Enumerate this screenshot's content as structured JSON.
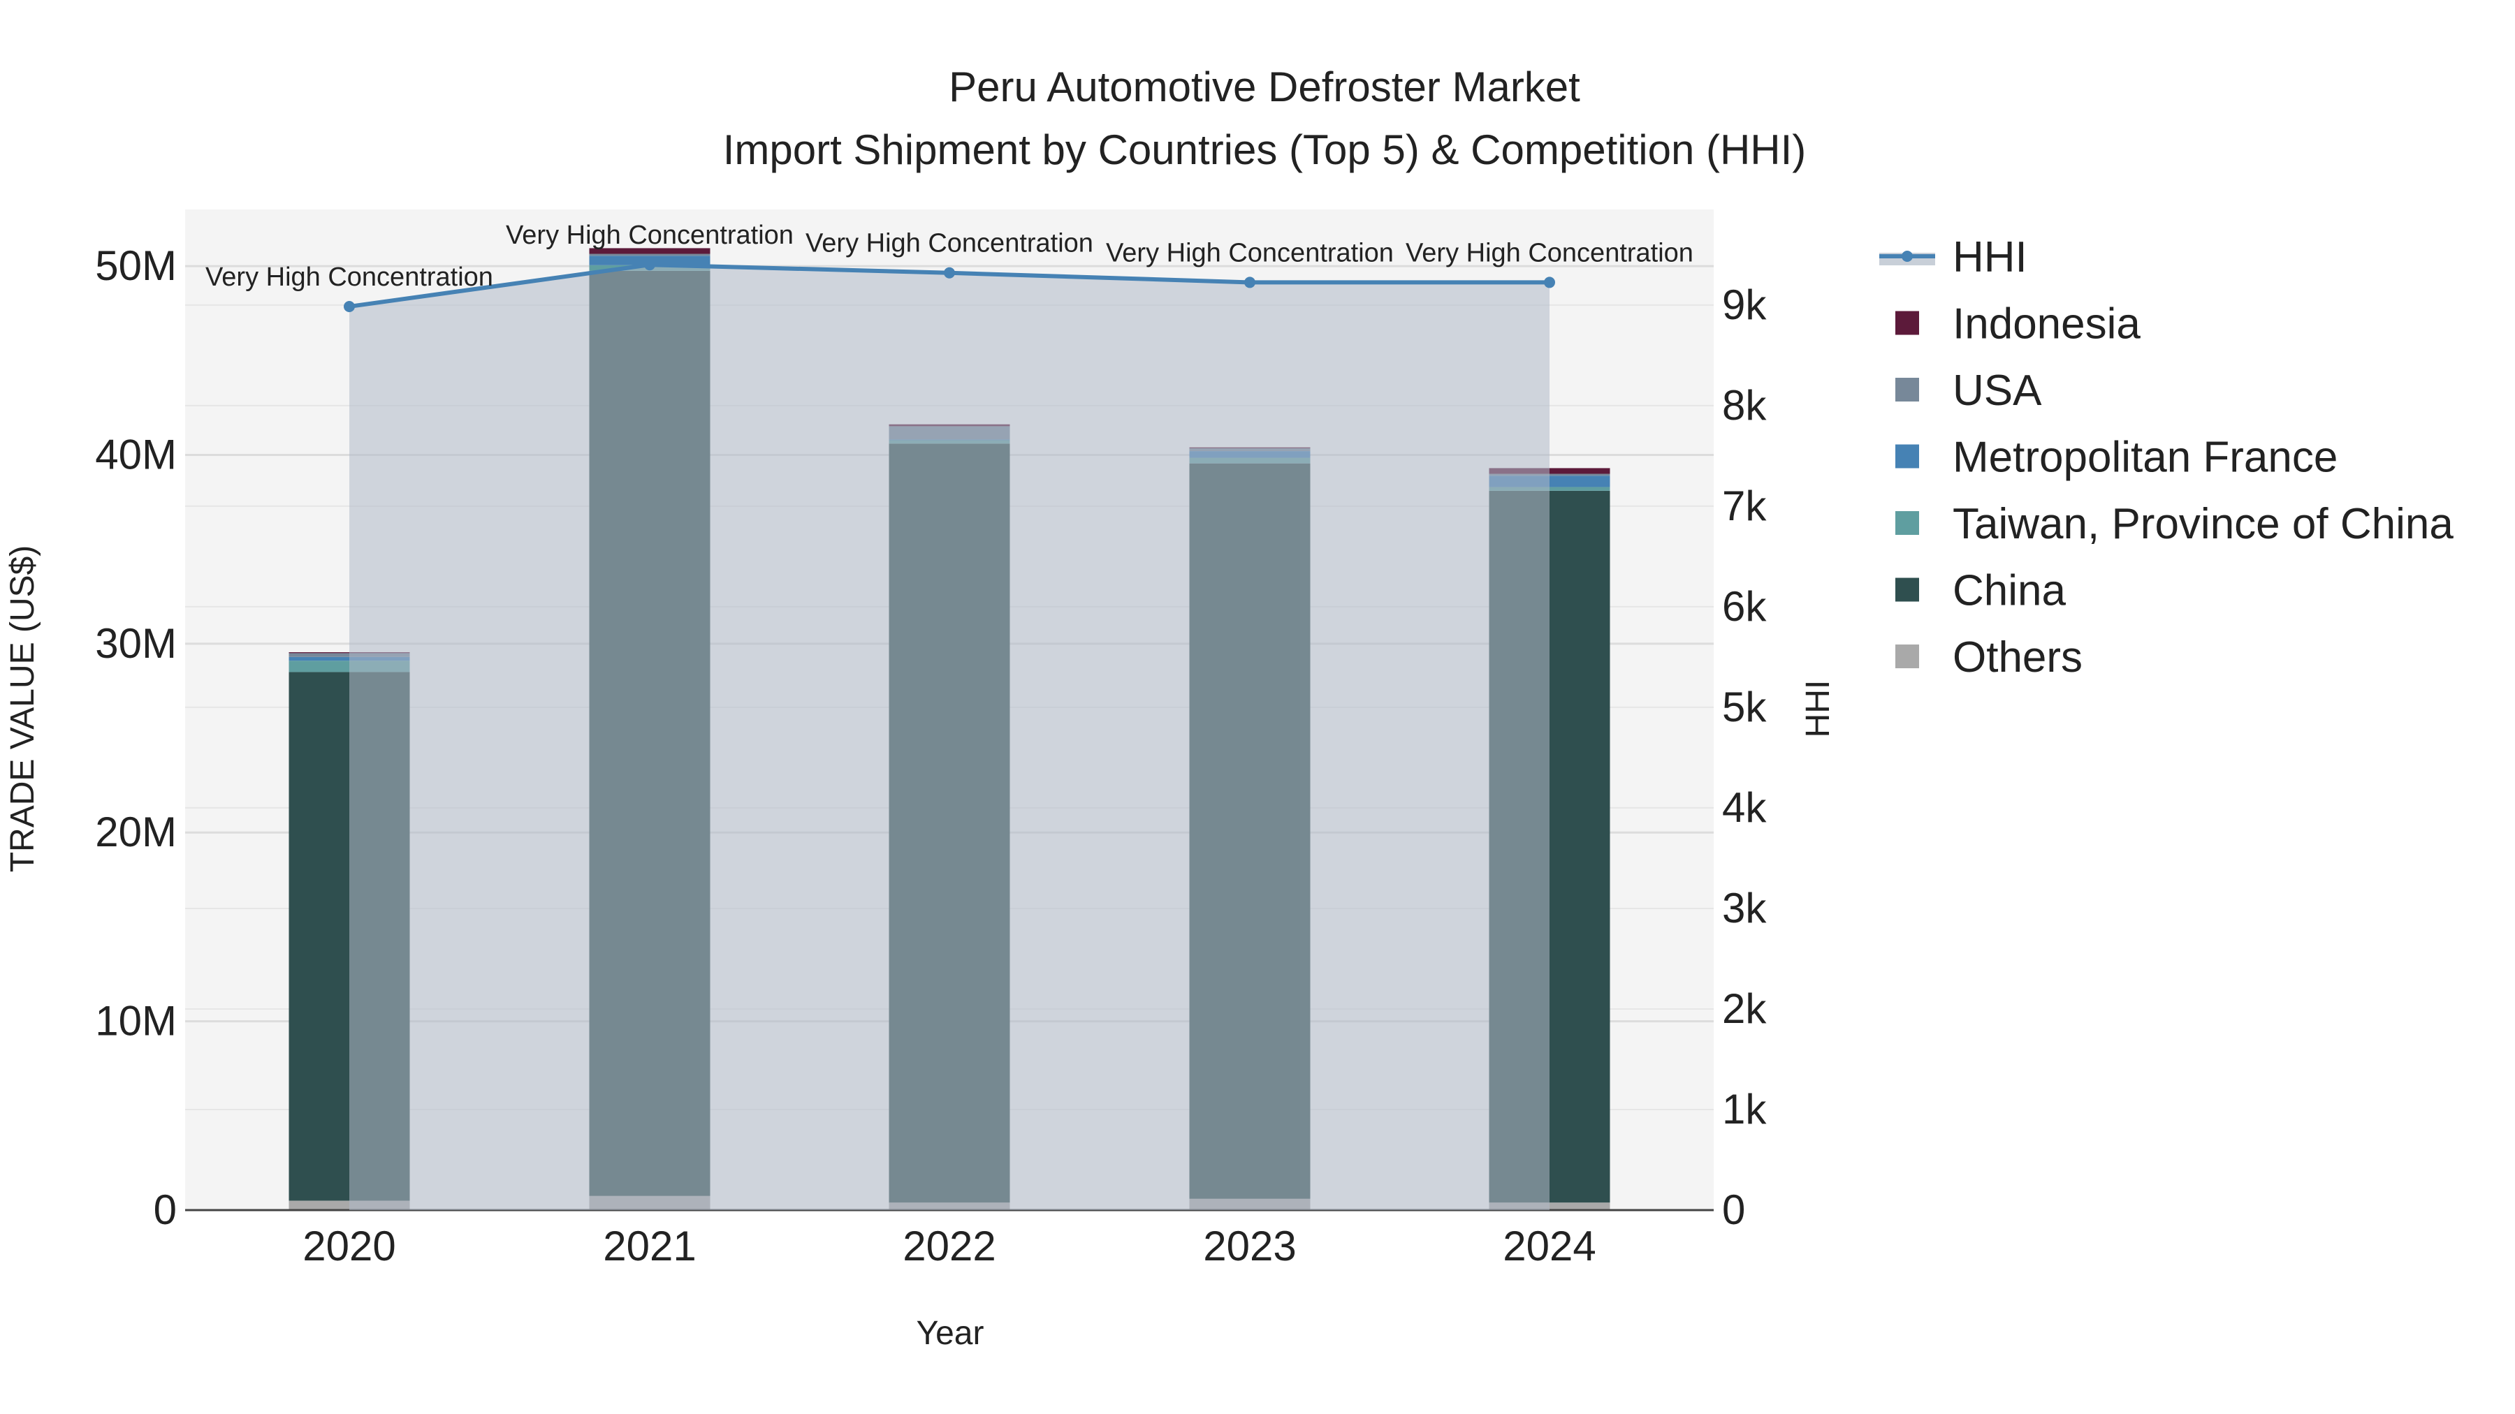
{
  "chart_data": {
    "type": "bar",
    "title": "Peru Automotive Defroster Market",
    "subtitle": "Import Shipment by Countries (Top 5) & Competition (HHI)",
    "xlabel": "Year",
    "ylabel": "TRADE VALUE (US$)",
    "y2label": "HHI",
    "categories": [
      "2020",
      "2021",
      "2022",
      "2023",
      "2024"
    ],
    "ylim": [
      0,
      53000000
    ],
    "y2lim": [
      0,
      9950
    ],
    "yticks": [
      {
        "v": 0,
        "label": "0"
      },
      {
        "v": 10000000,
        "label": "10M"
      },
      {
        "v": 20000000,
        "label": "20M"
      },
      {
        "v": 30000000,
        "label": "30M"
      },
      {
        "v": 40000000,
        "label": "40M"
      },
      {
        "v": 50000000,
        "label": "50M"
      }
    ],
    "y2ticks": [
      {
        "v": 0,
        "label": "0"
      },
      {
        "v": 1000,
        "label": "1k"
      },
      {
        "v": 2000,
        "label": "2k"
      },
      {
        "v": 3000,
        "label": "3k"
      },
      {
        "v": 4000,
        "label": "4k"
      },
      {
        "v": 5000,
        "label": "5k"
      },
      {
        "v": 6000,
        "label": "6k"
      },
      {
        "v": 7000,
        "label": "7k"
      },
      {
        "v": 8000,
        "label": "8k"
      },
      {
        "v": 9000,
        "label": "9k"
      }
    ],
    "series": [
      {
        "name": "Others",
        "color": "#a9a9a9",
        "values": [
          500000,
          750000,
          400000,
          600000,
          400000
        ]
      },
      {
        "name": "China",
        "color": "#2f4f4f",
        "values": [
          28000000,
          49000000,
          40200000,
          38950000,
          37700000
        ]
      },
      {
        "name": "Taiwan, Province of China",
        "color": "#5f9ea0",
        "values": [
          600000,
          300000,
          200000,
          300000,
          200000
        ]
      },
      {
        "name": "Metropolitan France",
        "color": "#4682b4",
        "values": [
          200000,
          500000,
          20000,
          350000,
          600000
        ]
      },
      {
        "name": "USA",
        "color": "#778899",
        "values": [
          200000,
          100000,
          700000,
          150000,
          100000
        ]
      },
      {
        "name": "Indonesia",
        "color": "#5c1a3a",
        "values": [
          50000,
          300000,
          100000,
          50000,
          300000
        ]
      }
    ],
    "hhi": {
      "name": "HHI",
      "color": "#4682b4",
      "values": [
        8985,
        9400,
        9320,
        9225,
        9225
      ],
      "labels": [
        "Very High Concentration",
        "Very High Concentration",
        "Very High Concentration",
        "Very High Concentration",
        "Very High Concentration"
      ]
    },
    "legend_order": [
      "HHI",
      "Indonesia",
      "USA",
      "Metropolitan France",
      "Taiwan, Province of China",
      "China",
      "Others"
    ],
    "legend_position": "right",
    "grid": true
  }
}
